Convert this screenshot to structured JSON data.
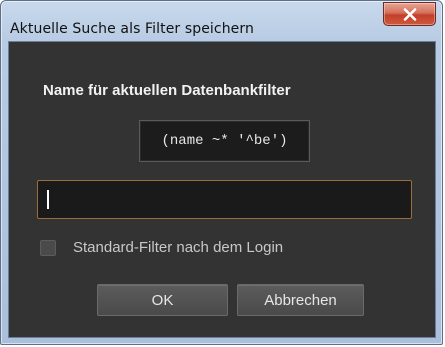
{
  "window": {
    "title": "Aktuelle Suche als Filter speichern",
    "close_icon": "close-icon"
  },
  "dialog": {
    "heading": "Name für aktuellen Datenbankfilter",
    "filter_expression": "(name ~* '^be')",
    "name_input_value": "",
    "checkbox_label": "Standard-Filter nach dem Login",
    "checkbox_checked": false,
    "ok_label": "OK",
    "cancel_label": "Abbrechen"
  },
  "colors": {
    "titlebar": "#b7cbe3",
    "close_button": "#c2402a",
    "dialog_background": "#333333",
    "input_border_focus": "#9a6e3a"
  }
}
